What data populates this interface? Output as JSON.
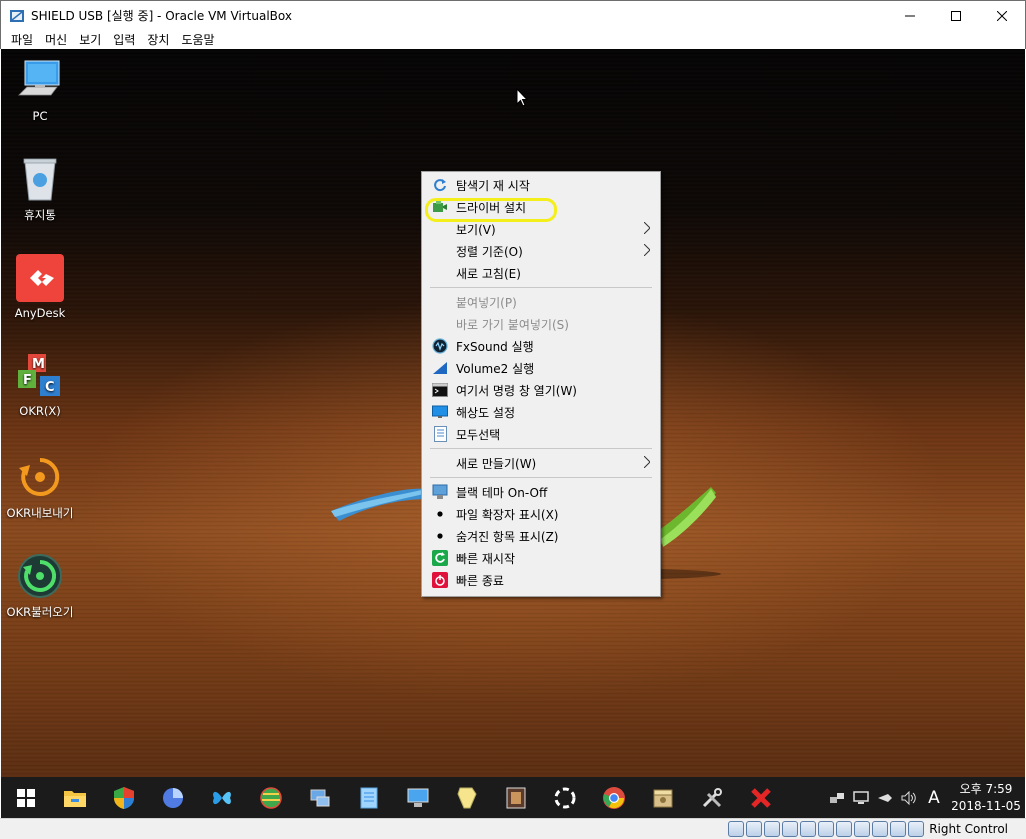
{
  "window": {
    "title": "SHIELD USB [실행 중] - Oracle VM VirtualBox"
  },
  "menubar": [
    "파일",
    "머신",
    "보기",
    "입력",
    "장치",
    "도움말"
  ],
  "desktop_icons": [
    {
      "label": "PC",
      "icon": "computer-icon"
    },
    {
      "label": "휴지통",
      "icon": "recycle-bin-icon"
    },
    {
      "label": "AnyDesk",
      "icon": "anydesk-icon"
    },
    {
      "label": "OKR(X)",
      "icon": "okr-blocks-icon"
    },
    {
      "label": "OKR내보내기",
      "icon": "okr-export-icon"
    },
    {
      "label": "OKR불러오기",
      "icon": "okr-import-icon"
    }
  ],
  "context_menu": {
    "items": [
      {
        "label": "탐색기 재 시작",
        "icon": "refresh-icon"
      },
      {
        "label": "드라이버 설치",
        "icon": "driver-install-icon",
        "highlighted": true
      },
      {
        "label": "보기(V)",
        "submenu": true
      },
      {
        "label": "정렬 기준(O)",
        "submenu": true
      },
      {
        "label": "새로 고침(E)"
      },
      {
        "label": "붙여넣기(P)",
        "disabled": true
      },
      {
        "label": "바로 가기 붙여넣기(S)",
        "disabled": true
      },
      {
        "label": "FxSound 실행",
        "icon": "fxsound-icon"
      },
      {
        "label": "Volume2 실행",
        "icon": "volume2-icon"
      },
      {
        "label": "여기서 명령 창 열기(W)",
        "icon": "cmd-icon"
      },
      {
        "label": "해상도 설정",
        "icon": "display-icon"
      },
      {
        "label": "모두선택",
        "icon": "select-all-icon"
      },
      {
        "label": "새로 만들기(W)",
        "submenu": true
      },
      {
        "label": "블랙 테마 On-Off",
        "icon": "theme-icon"
      },
      {
        "label": "파일 확장자 표시(X)",
        "icon": "bullet-icon"
      },
      {
        "label": "숨겨진 항목 표시(Z)",
        "icon": "bullet-icon"
      },
      {
        "label": "빠른 재시작",
        "icon": "restart-icon"
      },
      {
        "label": "빠른 종료",
        "icon": "shutdown-icon"
      }
    ]
  },
  "taskbar": {
    "apps": [
      "start-icon",
      "file-explorer-icon",
      "security-shield-icon",
      "disk-pie-icon",
      "butterfly-icon",
      "globe-app-icon",
      "network-app-icon",
      "notepad-app-icon",
      "computer-app-icon",
      "cleaner-app-icon",
      "film-app-icon",
      "capture-app-icon",
      "chrome-icon",
      "archive-app-icon",
      "tools-icon",
      "close-red-icon"
    ],
    "tray": {
      "ime": "A",
      "clock_time": "오후 7:59",
      "clock_date": "2018-11-05"
    }
  },
  "statusbar": {
    "host_key": "Right Control"
  }
}
